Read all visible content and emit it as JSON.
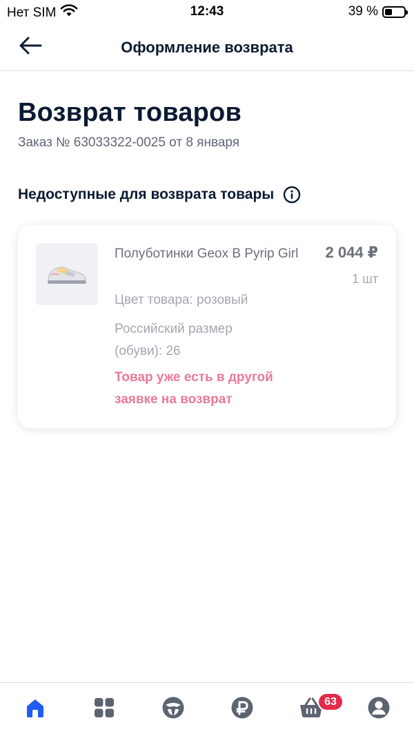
{
  "status_bar": {
    "carrier": "Нет SIM",
    "time": "12:43",
    "battery_percent_label": "39 %",
    "battery_level": 0.39
  },
  "header": {
    "title": "Оформление возврата",
    "back_icon": "arrow-left-icon"
  },
  "page": {
    "title": "Возврат товаров",
    "order_subtitle": "Заказ № 63033322-0025 от 8 января"
  },
  "section": {
    "title": "Недоступные для возврата товары",
    "info_icon": "info-icon"
  },
  "product": {
    "name": "Полуботинки Geox B Pyrip Girl",
    "price": "2 044 ₽",
    "quantity": "1 шт",
    "color": "Цвет товара: розовый",
    "size": "Российский размер (обуви): 26",
    "warning": "Товар уже есть в другой заявке на возврат",
    "image_icon": "sneaker-image"
  },
  "tab_bar": {
    "items": [
      {
        "icon": "home-icon",
        "active": true
      },
      {
        "icon": "catalog-icon",
        "active": false
      },
      {
        "icon": "steering-wheel-icon",
        "active": false
      },
      {
        "icon": "ruble-icon",
        "active": false
      },
      {
        "icon": "basket-icon",
        "active": false
      },
      {
        "icon": "profile-icon",
        "active": false
      }
    ],
    "basket_badge": "63"
  },
  "colors": {
    "accent": "#1f5cf0",
    "text_dark": "#0b1a33",
    "muted": "#a3a7af",
    "warning": "#e87a96",
    "badge": "#e5294b",
    "tab_inactive": "#5c6470"
  }
}
